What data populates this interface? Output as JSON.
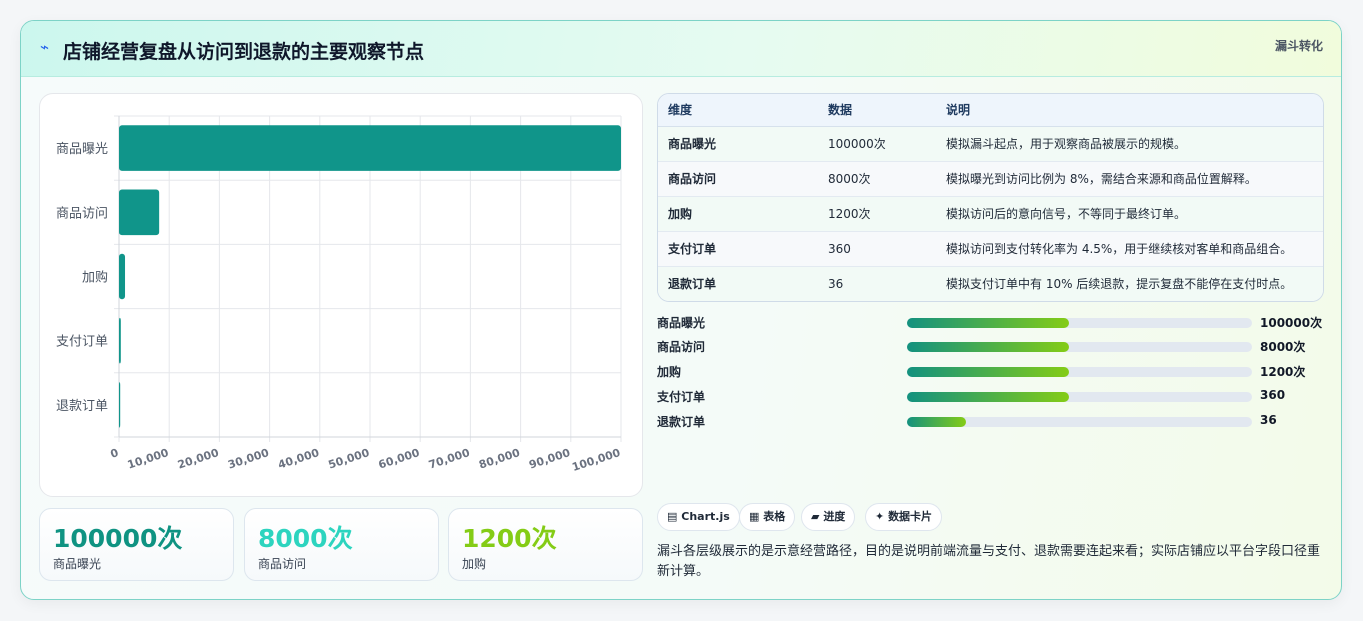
{
  "header": {
    "title": "店铺经营复盘从访问到退款的主要观察节点",
    "tag": "漏斗转化",
    "icon": "pulse-icon"
  },
  "chart_data": {
    "type": "bar",
    "orientation": "horizontal",
    "categories": [
      "商品曝光",
      "商品访问",
      "加购",
      "支付订单",
      "退款订单"
    ],
    "values": [
      100000,
      8000,
      1200,
      360,
      36
    ],
    "xlim": [
      0,
      100000
    ],
    "xticks": [
      "0",
      "10,000",
      "20,000",
      "30,000",
      "40,000",
      "50,000",
      "60,000",
      "70,000",
      "80,000",
      "90,000",
      "100,000"
    ],
    "grid": true,
    "color": "#10958a"
  },
  "stats": [
    {
      "value": "100000次",
      "label": "商品曝光",
      "color": "#0f9382"
    },
    {
      "value": "8000次",
      "label": "商品访问",
      "color": "#2dd4bf"
    },
    {
      "value": "1200次",
      "label": "加购",
      "color": "#84cc16"
    }
  ],
  "table": {
    "headers": [
      "维度",
      "数据",
      "说明"
    ],
    "rows": [
      [
        "商品曝光",
        "100000次",
        "模拟漏斗起点，用于观察商品被展示的规模。"
      ],
      [
        "商品访问",
        "8000次",
        "模拟曝光到访问比例为 8%，需结合来源和商品位置解释。"
      ],
      [
        "加购",
        "1200次",
        "模拟访问后的意向信号，不等同于最终订单。"
      ],
      [
        "支付订单",
        "360",
        "模拟访问到支付转化率为 4.5%，用于继续核对客单和商品组合。"
      ],
      [
        "退款订单",
        "36",
        "模拟支付订单中有 10% 后续退款，提示复盘不能停在支付时点。"
      ]
    ]
  },
  "progress": [
    {
      "label": "商品曝光",
      "value": "100000次",
      "fill_fraction": 0.47
    },
    {
      "label": "商品访问",
      "value": "8000次",
      "fill_fraction": 0.47
    },
    {
      "label": "加购",
      "value": "1200次",
      "fill_fraction": 0.47
    },
    {
      "label": "支付订单",
      "value": "360",
      "fill_fraction": 0.47
    },
    {
      "label": "退款订单",
      "value": "36",
      "fill_fraction": 0.17
    }
  ],
  "chips": [
    {
      "icon": "▤",
      "label": "Chart.js"
    },
    {
      "icon": "▦",
      "label": "表格"
    },
    {
      "icon": "▰",
      "label": "进度"
    },
    {
      "icon": "✦",
      "label": "数据卡片"
    }
  ],
  "note": "漏斗各层级展示的是示意经营路径，目的是说明前端流量与支付、退款需要连起来看；实际店铺应以平台字段口径重新计算。"
}
